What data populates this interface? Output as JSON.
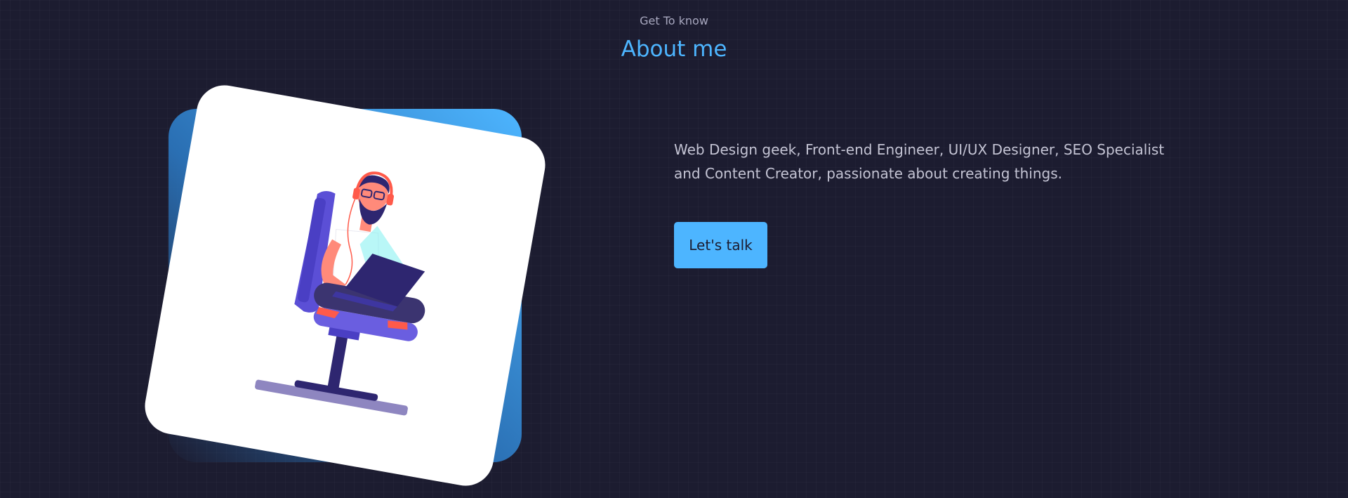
{
  "header": {
    "subtitle": "Get To know",
    "title": "About me"
  },
  "about": {
    "description": "Web Design geek, Front-end Engineer, UI/UX Designer, SEO Specialist and Content Creator, passionate about creating things.",
    "cta_label": "Let's talk"
  },
  "colors": {
    "background": "#1c1c30",
    "accent": "#4db5ff",
    "text_muted": "#c4c4d4",
    "illustration_chair": "#5b4fd6",
    "illustration_dark": "#2e2670"
  }
}
